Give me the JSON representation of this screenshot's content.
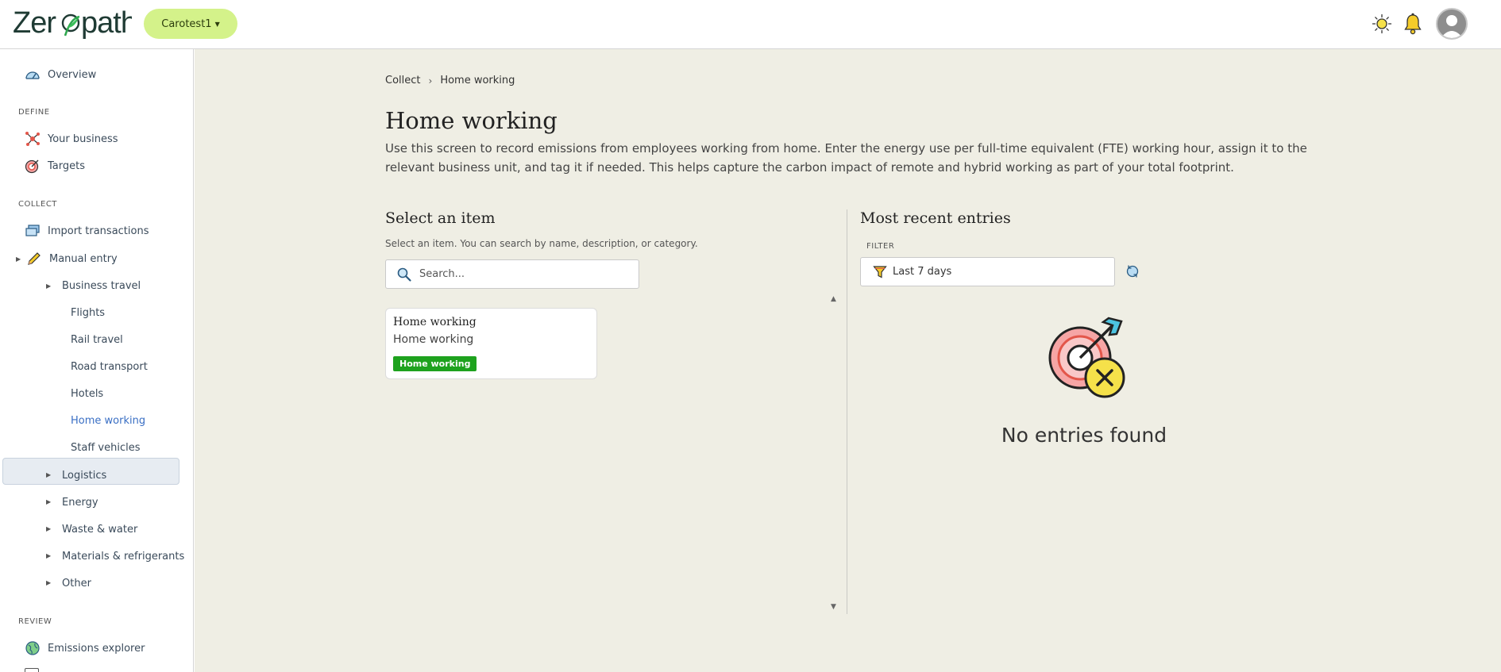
{
  "header": {
    "logo_text": "Zeropath",
    "org_label": "Carotest1",
    "icons": {
      "theme": "sun-icon",
      "notifications": "bell-icon",
      "avatar": "user-avatar"
    }
  },
  "sidebar": {
    "overview": "Overview",
    "sections": {
      "define": "DEFINE",
      "collect": "COLLECT",
      "review": "REVIEW"
    },
    "define_items": [
      "Your business",
      "Targets"
    ],
    "collect_items": {
      "import": "Import transactions",
      "manual": "Manual entry",
      "business_travel": "Business travel",
      "travel_children": [
        "Flights",
        "Rail travel",
        "Road transport",
        "Hotels",
        "Home working",
        "Staff vehicles"
      ],
      "groups": [
        "Logistics",
        "Energy",
        "Waste & water",
        "Materials & refrigerants",
        "Other"
      ]
    },
    "review_items": [
      "Emissions explorer"
    ],
    "active": "Home working"
  },
  "main": {
    "breadcrumb": [
      "Collect",
      "Home working"
    ],
    "title": "Home working",
    "description": "Use this screen to record emissions from employees working from home. Enter the energy use per full-time equivalent (FTE) working hour, assign it to the relevant business unit, and tag it if needed. This helps capture the carbon impact of remote and hybrid working as part of your total footprint.",
    "select": {
      "heading": "Select an item",
      "hint": "Select an item. You can search by name, description, or category.",
      "search_placeholder": "Search...",
      "items": [
        {
          "title": "Home working",
          "subtitle": "Home working",
          "badge": "Home working"
        }
      ]
    },
    "recent": {
      "heading": "Most recent entries",
      "filter_label": "FILTER",
      "filter_value": "Last 7 days",
      "empty_text": "No entries found"
    }
  },
  "colors": {
    "brand_green": "#2f7d4a",
    "org_pill": "#d4f28a",
    "badge_green": "#1ea21e",
    "main_bg": "#efeee4",
    "active_nav_text": "#3a6fc4"
  }
}
